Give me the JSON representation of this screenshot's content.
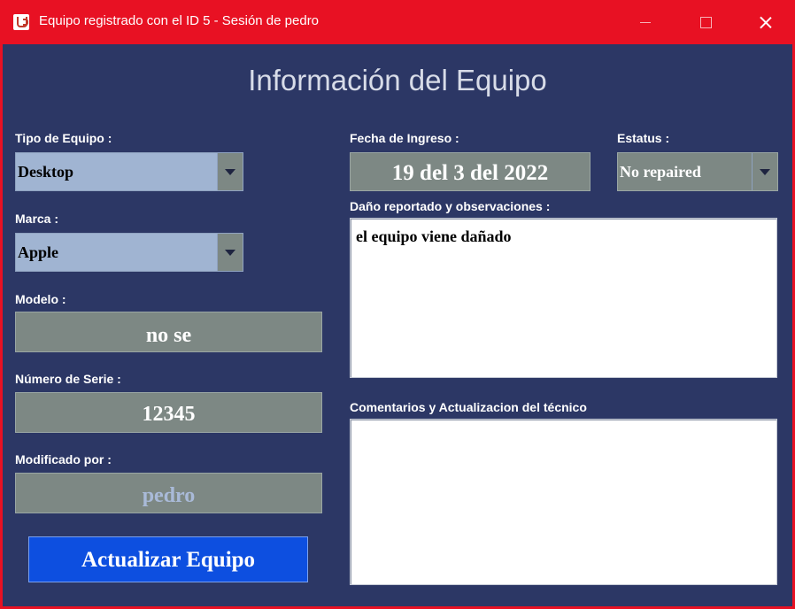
{
  "window": {
    "title": "Equipo registrado con el ID 5 - Sesión de pedro",
    "controls": [
      "minimize-icon",
      "maximize-icon",
      "close-icon"
    ]
  },
  "form": {
    "title": "Información del Equipo",
    "tipo_label": "Tipo de Equipo :",
    "tipo_value": "Desktop",
    "marca_label": "Marca :",
    "marca_value": "Apple",
    "modelo_label": "Modelo :",
    "modelo_value": "no se",
    "serie_label": "Número de Serie :",
    "serie_value": "12345",
    "modificado_label": "Modificado por :",
    "modificado_value": "pedro",
    "update_button": "Actualizar Equipo",
    "fecha_label": "Fecha de Ingreso :",
    "fecha_value": "19 del 3 del 2022",
    "estatus_label": "Estatus :",
    "estatus_value": "No repaired",
    "danio_label": "Daño reportado y observaciones :",
    "danio_value": "el equipo viene dañado",
    "comentarios_label": "Comentarios y Actualizacion del técnico",
    "comentarios_value": ""
  },
  "colors": {
    "titlebar": "#e81123",
    "background": "#2c3765",
    "field": "#7d8884",
    "combo": "#a0b4d2",
    "button": "#0d4fe0"
  }
}
